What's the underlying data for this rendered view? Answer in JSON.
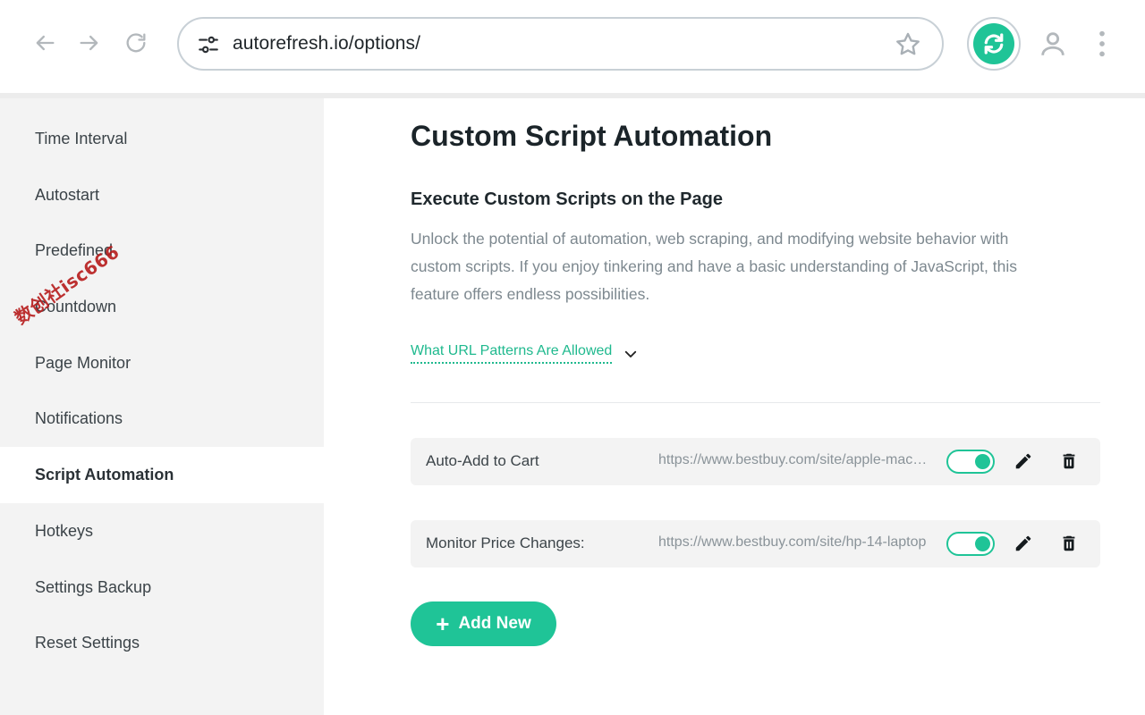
{
  "browser": {
    "url": "autorefresh.io/options/",
    "back_icon": "arrow-left-icon",
    "forward_icon": "arrow-right-icon",
    "reload_icon": "reload-icon",
    "extension_icon": "refresh-icon",
    "accent": "#1fc497"
  },
  "sidebar": {
    "items": [
      {
        "label": "Time Interval"
      },
      {
        "label": "Autostart"
      },
      {
        "label": "Predefined"
      },
      {
        "label": "Countdown"
      },
      {
        "label": "Page Monitor"
      },
      {
        "label": "Notifications"
      },
      {
        "label": "Script Automation",
        "active": true
      },
      {
        "label": "Hotkeys"
      },
      {
        "label": "Settings Backup"
      },
      {
        "label": "Reset Settings"
      }
    ]
  },
  "watermark": "数创社isc666",
  "main": {
    "title": "Custom Script Automation",
    "section_title": "Execute Custom Scripts on the Page",
    "description": "Unlock the potential of automation, web scraping, and modifying website behavior with custom scripts. If you enjoy tinkering and have a basic understanding of JavaScript, this feature offers endless possibilities.",
    "patterns_link": "What URL Patterns Are Allowed",
    "scripts": [
      {
        "name": "Auto-Add to Cart",
        "url": "https://www.bestbuy.com/site/apple-macbook-air",
        "enabled": true
      },
      {
        "name": "Monitor Price Changes:",
        "url": "https://www.bestbuy.com/site/hp-14-laptop",
        "enabled": true
      }
    ],
    "add_button": "Add New"
  }
}
